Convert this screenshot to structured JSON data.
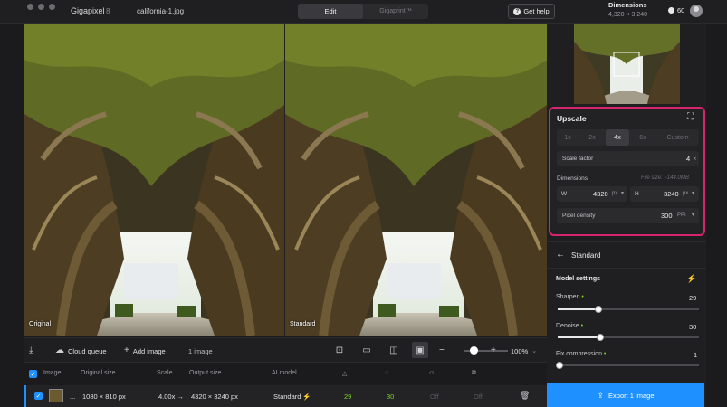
{
  "titlebar": {
    "app_name": "Gigapixel",
    "app_version": "8",
    "file_name": "california-1.jpg",
    "mode_tabs": [
      "Edit",
      "Gigaprint™"
    ],
    "help_label": "Get help",
    "dimensions_label": "Dimensions",
    "dimensions_value": "4,320 × 3,240",
    "credits": "60"
  },
  "viewer": {
    "left_label": "Original",
    "right_label": "Standard"
  },
  "toolbar": {
    "cloud_queue": "Cloud queue",
    "add_image": "Add image",
    "image_count": "1 image",
    "zoom": "100%"
  },
  "queue": {
    "headers": [
      "Image",
      "Original size",
      "Scale",
      "Output size",
      "AI model"
    ],
    "row": {
      "ellipsis": "...",
      "original_size": "1080 × 810 px",
      "scale": "4.00x →",
      "output_size": "4320 × 3240 px",
      "model": "Standard",
      "sharpen": "29",
      "denoise": "30",
      "col3": "Off",
      "col4": "Off"
    }
  },
  "upscale": {
    "title": "Upscale",
    "scale_options": [
      "1x",
      "2x",
      "4x",
      "6x",
      "Custom"
    ],
    "selected_scale": "4x",
    "scale_factor_label": "Scale factor",
    "scale_factor_value": "4",
    "scale_factor_unit": "x",
    "dimensions_label": "Dimensions",
    "file_size": "File size: ~144.0MB",
    "width_label": "W",
    "width_value": "4320",
    "height_label": "H",
    "height_value": "3240",
    "unit": "px",
    "pixel_density_label": "Pixel density",
    "pixel_density_value": "300",
    "pixel_density_unit": "PPI"
  },
  "model": {
    "back_label": "Standard",
    "settings_label": "Model settings",
    "sharpen_label": "Sharpen",
    "sharpen_value": "29",
    "sharpen_level": 0.29,
    "denoise_label": "Denoise",
    "denoise_value": "30",
    "denoise_level": 0.3,
    "fix_label": "Fix compression",
    "fix_value": "1",
    "fix_level": 0.01
  },
  "export": {
    "label": "Export 1 image"
  },
  "colors": {
    "accent": "#1e90ff",
    "highlight": "#d6246e",
    "green": "#7ed321"
  }
}
